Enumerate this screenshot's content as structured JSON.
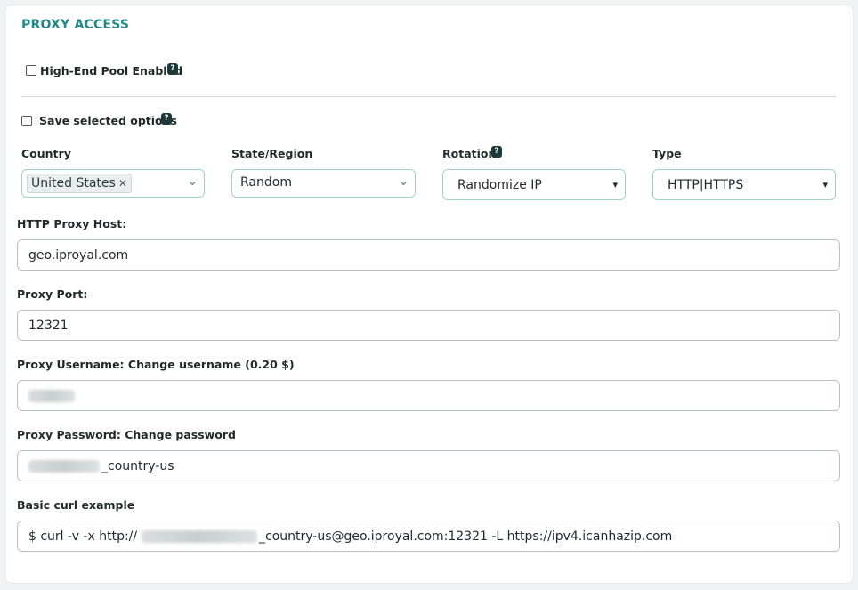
{
  "section_title": "PROXY ACCESS",
  "high_end_pool": {
    "label": "High-End Pool Enabled",
    "checked": false,
    "help": "?"
  },
  "save_options": {
    "label": "Save selected options",
    "checked": false,
    "help": "?"
  },
  "selectors": {
    "country": {
      "label": "Country",
      "selected_chip": "United States",
      "remove_glyph": "✕"
    },
    "state": {
      "label": "State/Region",
      "value": "Random"
    },
    "rotation": {
      "label": "Rotation",
      "value": "Randomize IP",
      "help": "?"
    },
    "type": {
      "label": "Type",
      "value": "HTTP|HTTPS"
    }
  },
  "fields": {
    "host": {
      "label": "HTTP Proxy Host:",
      "value": "geo.iproyal.com"
    },
    "port": {
      "label": "Proxy Port:",
      "value": "12321"
    },
    "username": {
      "label": "Proxy Username: Change username (0.20 $)"
    },
    "password": {
      "label": "Proxy Password: Change password",
      "suffix": "_country-us"
    },
    "curl": {
      "label": "Basic curl example",
      "prefix": "$ curl -v -x http://",
      "suffix": "_country-us@geo.iproyal.com:12321 -L https://ipv4.icanhazip.com"
    }
  },
  "icons": {
    "chevron_down": "⌄",
    "select_arrow": "▾"
  },
  "colors": {
    "title": "#1e8a8a",
    "help_badge": "#1a3a3a",
    "select_border": "#9fd3d0",
    "input_border": "#b7c3c3"
  }
}
